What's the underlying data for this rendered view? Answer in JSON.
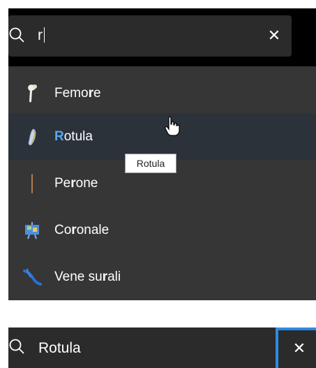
{
  "top_search": {
    "query": "r",
    "clear_label": "✕",
    "icon": "search-icon"
  },
  "results": [
    {
      "label_parts": [
        "Femo",
        "r",
        "e"
      ],
      "icon": "femur-bone-icon"
    },
    {
      "label_parts": [
        "",
        "R",
        "otula"
      ],
      "icon": "patella-bone-icon",
      "highlighted": true
    },
    {
      "label_parts": [
        "Pe",
        "r",
        "one"
      ],
      "icon": "fibula-bone-icon"
    },
    {
      "label_parts": [
        "Co",
        "r",
        "onale"
      ],
      "icon": "coronal-plane-icon"
    },
    {
      "label_parts": [
        "Vene su",
        "r",
        "ali"
      ],
      "icon": "sural-veins-icon"
    }
  ],
  "tooltip": {
    "text": "Rotula"
  },
  "bottom_search": {
    "query": "Rotula",
    "clear_label": "✕",
    "icon": "search-icon"
  },
  "colors": {
    "match_highlight": "#5aa6f0",
    "focus_border": "#2a8be8",
    "panel_bg": "#363636"
  }
}
